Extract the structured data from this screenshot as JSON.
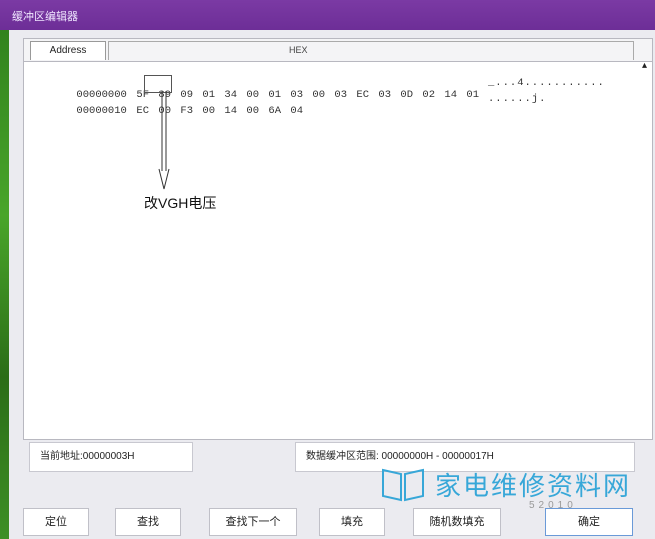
{
  "window": {
    "title": "缓冲区编辑器"
  },
  "editor": {
    "tab_address": "Address",
    "tab_hex": "HEX",
    "rows": [
      {
        "address": "00000000",
        "bytes": [
          "5F",
          "89",
          "09",
          "01",
          "34",
          "00",
          "01",
          "03",
          "00",
          "03",
          "EC",
          "03",
          "0D",
          "02",
          "14",
          "01"
        ],
        "ascii": "_...4..........."
      },
      {
        "address": "00000010",
        "bytes": [
          "EC",
          "00",
          "F3",
          "00",
          "14",
          "00",
          "6A",
          "04"
        ],
        "ascii": "......j."
      }
    ],
    "annotation": "改VGH电压"
  },
  "status": {
    "current_address": "当前地址:00000003H",
    "buffer_range": "数据缓冲区范围: 00000000H - 00000017H"
  },
  "buttons": {
    "locate": "定位",
    "find": "查找",
    "find_next": "查找下一个",
    "fill": "填充",
    "random_fill": "随机数填充",
    "ok": "确定"
  },
  "watermark": {
    "text": "家电维修资料网",
    "number": "52010"
  }
}
